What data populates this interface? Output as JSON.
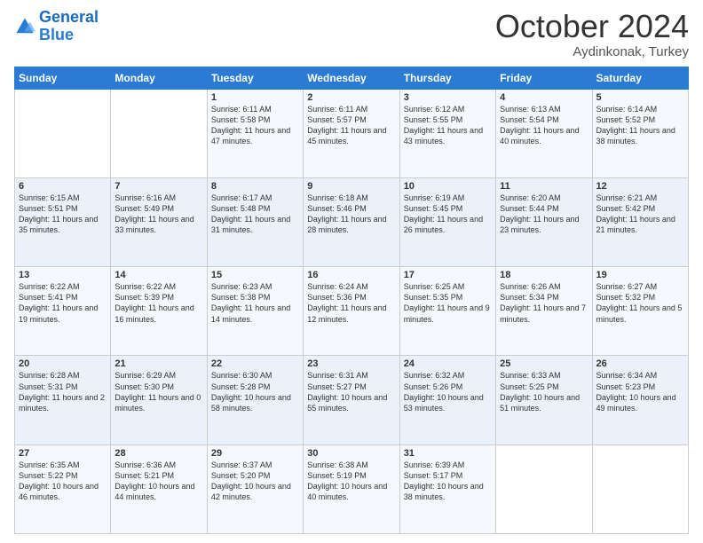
{
  "header": {
    "logo_line1": "General",
    "logo_line2": "Blue",
    "month": "October 2024",
    "location": "Aydinkonak, Turkey"
  },
  "weekdays": [
    "Sunday",
    "Monday",
    "Tuesday",
    "Wednesday",
    "Thursday",
    "Friday",
    "Saturday"
  ],
  "weeks": [
    [
      {
        "day": "",
        "info": ""
      },
      {
        "day": "",
        "info": ""
      },
      {
        "day": "1",
        "info": "Sunrise: 6:11 AM\nSunset: 5:58 PM\nDaylight: 11 hours and 47 minutes."
      },
      {
        "day": "2",
        "info": "Sunrise: 6:11 AM\nSunset: 5:57 PM\nDaylight: 11 hours and 45 minutes."
      },
      {
        "day": "3",
        "info": "Sunrise: 6:12 AM\nSunset: 5:55 PM\nDaylight: 11 hours and 43 minutes."
      },
      {
        "day": "4",
        "info": "Sunrise: 6:13 AM\nSunset: 5:54 PM\nDaylight: 11 hours and 40 minutes."
      },
      {
        "day": "5",
        "info": "Sunrise: 6:14 AM\nSunset: 5:52 PM\nDaylight: 11 hours and 38 minutes."
      }
    ],
    [
      {
        "day": "6",
        "info": "Sunrise: 6:15 AM\nSunset: 5:51 PM\nDaylight: 11 hours and 35 minutes."
      },
      {
        "day": "7",
        "info": "Sunrise: 6:16 AM\nSunset: 5:49 PM\nDaylight: 11 hours and 33 minutes."
      },
      {
        "day": "8",
        "info": "Sunrise: 6:17 AM\nSunset: 5:48 PM\nDaylight: 11 hours and 31 minutes."
      },
      {
        "day": "9",
        "info": "Sunrise: 6:18 AM\nSunset: 5:46 PM\nDaylight: 11 hours and 28 minutes."
      },
      {
        "day": "10",
        "info": "Sunrise: 6:19 AM\nSunset: 5:45 PM\nDaylight: 11 hours and 26 minutes."
      },
      {
        "day": "11",
        "info": "Sunrise: 6:20 AM\nSunset: 5:44 PM\nDaylight: 11 hours and 23 minutes."
      },
      {
        "day": "12",
        "info": "Sunrise: 6:21 AM\nSunset: 5:42 PM\nDaylight: 11 hours and 21 minutes."
      }
    ],
    [
      {
        "day": "13",
        "info": "Sunrise: 6:22 AM\nSunset: 5:41 PM\nDaylight: 11 hours and 19 minutes."
      },
      {
        "day": "14",
        "info": "Sunrise: 6:22 AM\nSunset: 5:39 PM\nDaylight: 11 hours and 16 minutes."
      },
      {
        "day": "15",
        "info": "Sunrise: 6:23 AM\nSunset: 5:38 PM\nDaylight: 11 hours and 14 minutes."
      },
      {
        "day": "16",
        "info": "Sunrise: 6:24 AM\nSunset: 5:36 PM\nDaylight: 11 hours and 12 minutes."
      },
      {
        "day": "17",
        "info": "Sunrise: 6:25 AM\nSunset: 5:35 PM\nDaylight: 11 hours and 9 minutes."
      },
      {
        "day": "18",
        "info": "Sunrise: 6:26 AM\nSunset: 5:34 PM\nDaylight: 11 hours and 7 minutes."
      },
      {
        "day": "19",
        "info": "Sunrise: 6:27 AM\nSunset: 5:32 PM\nDaylight: 11 hours and 5 minutes."
      }
    ],
    [
      {
        "day": "20",
        "info": "Sunrise: 6:28 AM\nSunset: 5:31 PM\nDaylight: 11 hours and 2 minutes."
      },
      {
        "day": "21",
        "info": "Sunrise: 6:29 AM\nSunset: 5:30 PM\nDaylight: 11 hours and 0 minutes."
      },
      {
        "day": "22",
        "info": "Sunrise: 6:30 AM\nSunset: 5:28 PM\nDaylight: 10 hours and 58 minutes."
      },
      {
        "day": "23",
        "info": "Sunrise: 6:31 AM\nSunset: 5:27 PM\nDaylight: 10 hours and 55 minutes."
      },
      {
        "day": "24",
        "info": "Sunrise: 6:32 AM\nSunset: 5:26 PM\nDaylight: 10 hours and 53 minutes."
      },
      {
        "day": "25",
        "info": "Sunrise: 6:33 AM\nSunset: 5:25 PM\nDaylight: 10 hours and 51 minutes."
      },
      {
        "day": "26",
        "info": "Sunrise: 6:34 AM\nSunset: 5:23 PM\nDaylight: 10 hours and 49 minutes."
      }
    ],
    [
      {
        "day": "27",
        "info": "Sunrise: 6:35 AM\nSunset: 5:22 PM\nDaylight: 10 hours and 46 minutes."
      },
      {
        "day": "28",
        "info": "Sunrise: 6:36 AM\nSunset: 5:21 PM\nDaylight: 10 hours and 44 minutes."
      },
      {
        "day": "29",
        "info": "Sunrise: 6:37 AM\nSunset: 5:20 PM\nDaylight: 10 hours and 42 minutes."
      },
      {
        "day": "30",
        "info": "Sunrise: 6:38 AM\nSunset: 5:19 PM\nDaylight: 10 hours and 40 minutes."
      },
      {
        "day": "31",
        "info": "Sunrise: 6:39 AM\nSunset: 5:17 PM\nDaylight: 10 hours and 38 minutes."
      },
      {
        "day": "",
        "info": ""
      },
      {
        "day": "",
        "info": ""
      }
    ]
  ]
}
